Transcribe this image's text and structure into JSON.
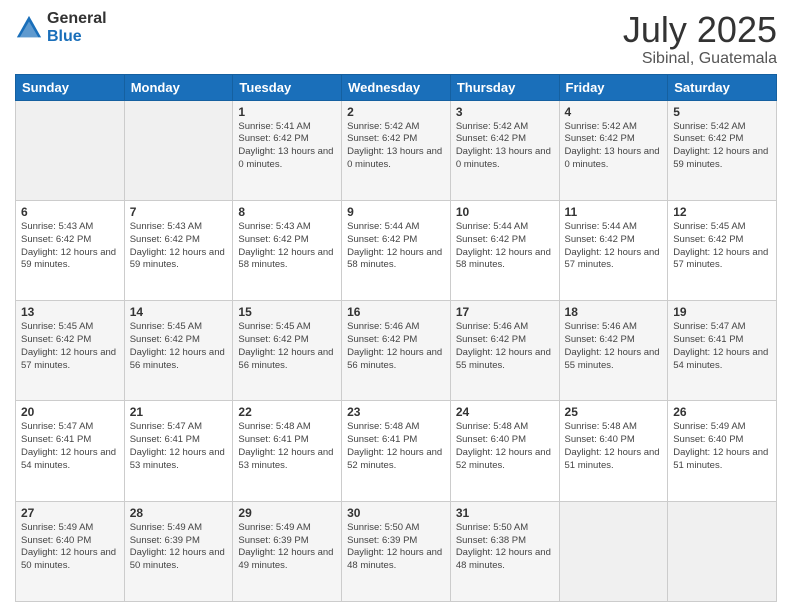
{
  "logo": {
    "general": "General",
    "blue": "Blue"
  },
  "header": {
    "title": "July 2025",
    "subtitle": "Sibinal, Guatemala"
  },
  "days_of_week": [
    "Sunday",
    "Monday",
    "Tuesday",
    "Wednesday",
    "Thursday",
    "Friday",
    "Saturday"
  ],
  "weeks": [
    [
      {
        "day": "",
        "info": ""
      },
      {
        "day": "",
        "info": ""
      },
      {
        "day": "1",
        "info": "Sunrise: 5:41 AM\nSunset: 6:42 PM\nDaylight: 13 hours and 0 minutes."
      },
      {
        "day": "2",
        "info": "Sunrise: 5:42 AM\nSunset: 6:42 PM\nDaylight: 13 hours and 0 minutes."
      },
      {
        "day": "3",
        "info": "Sunrise: 5:42 AM\nSunset: 6:42 PM\nDaylight: 13 hours and 0 minutes."
      },
      {
        "day": "4",
        "info": "Sunrise: 5:42 AM\nSunset: 6:42 PM\nDaylight: 13 hours and 0 minutes."
      },
      {
        "day": "5",
        "info": "Sunrise: 5:42 AM\nSunset: 6:42 PM\nDaylight: 12 hours and 59 minutes."
      }
    ],
    [
      {
        "day": "6",
        "info": "Sunrise: 5:43 AM\nSunset: 6:42 PM\nDaylight: 12 hours and 59 minutes."
      },
      {
        "day": "7",
        "info": "Sunrise: 5:43 AM\nSunset: 6:42 PM\nDaylight: 12 hours and 59 minutes."
      },
      {
        "day": "8",
        "info": "Sunrise: 5:43 AM\nSunset: 6:42 PM\nDaylight: 12 hours and 58 minutes."
      },
      {
        "day": "9",
        "info": "Sunrise: 5:44 AM\nSunset: 6:42 PM\nDaylight: 12 hours and 58 minutes."
      },
      {
        "day": "10",
        "info": "Sunrise: 5:44 AM\nSunset: 6:42 PM\nDaylight: 12 hours and 58 minutes."
      },
      {
        "day": "11",
        "info": "Sunrise: 5:44 AM\nSunset: 6:42 PM\nDaylight: 12 hours and 57 minutes."
      },
      {
        "day": "12",
        "info": "Sunrise: 5:45 AM\nSunset: 6:42 PM\nDaylight: 12 hours and 57 minutes."
      }
    ],
    [
      {
        "day": "13",
        "info": "Sunrise: 5:45 AM\nSunset: 6:42 PM\nDaylight: 12 hours and 57 minutes."
      },
      {
        "day": "14",
        "info": "Sunrise: 5:45 AM\nSunset: 6:42 PM\nDaylight: 12 hours and 56 minutes."
      },
      {
        "day": "15",
        "info": "Sunrise: 5:45 AM\nSunset: 6:42 PM\nDaylight: 12 hours and 56 minutes."
      },
      {
        "day": "16",
        "info": "Sunrise: 5:46 AM\nSunset: 6:42 PM\nDaylight: 12 hours and 56 minutes."
      },
      {
        "day": "17",
        "info": "Sunrise: 5:46 AM\nSunset: 6:42 PM\nDaylight: 12 hours and 55 minutes."
      },
      {
        "day": "18",
        "info": "Sunrise: 5:46 AM\nSunset: 6:42 PM\nDaylight: 12 hours and 55 minutes."
      },
      {
        "day": "19",
        "info": "Sunrise: 5:47 AM\nSunset: 6:41 PM\nDaylight: 12 hours and 54 minutes."
      }
    ],
    [
      {
        "day": "20",
        "info": "Sunrise: 5:47 AM\nSunset: 6:41 PM\nDaylight: 12 hours and 54 minutes."
      },
      {
        "day": "21",
        "info": "Sunrise: 5:47 AM\nSunset: 6:41 PM\nDaylight: 12 hours and 53 minutes."
      },
      {
        "day": "22",
        "info": "Sunrise: 5:48 AM\nSunset: 6:41 PM\nDaylight: 12 hours and 53 minutes."
      },
      {
        "day": "23",
        "info": "Sunrise: 5:48 AM\nSunset: 6:41 PM\nDaylight: 12 hours and 52 minutes."
      },
      {
        "day": "24",
        "info": "Sunrise: 5:48 AM\nSunset: 6:40 PM\nDaylight: 12 hours and 52 minutes."
      },
      {
        "day": "25",
        "info": "Sunrise: 5:48 AM\nSunset: 6:40 PM\nDaylight: 12 hours and 51 minutes."
      },
      {
        "day": "26",
        "info": "Sunrise: 5:49 AM\nSunset: 6:40 PM\nDaylight: 12 hours and 51 minutes."
      }
    ],
    [
      {
        "day": "27",
        "info": "Sunrise: 5:49 AM\nSunset: 6:40 PM\nDaylight: 12 hours and 50 minutes."
      },
      {
        "day": "28",
        "info": "Sunrise: 5:49 AM\nSunset: 6:39 PM\nDaylight: 12 hours and 50 minutes."
      },
      {
        "day": "29",
        "info": "Sunrise: 5:49 AM\nSunset: 6:39 PM\nDaylight: 12 hours and 49 minutes."
      },
      {
        "day": "30",
        "info": "Sunrise: 5:50 AM\nSunset: 6:39 PM\nDaylight: 12 hours and 48 minutes."
      },
      {
        "day": "31",
        "info": "Sunrise: 5:50 AM\nSunset: 6:38 PM\nDaylight: 12 hours and 48 minutes."
      },
      {
        "day": "",
        "info": ""
      },
      {
        "day": "",
        "info": ""
      }
    ]
  ]
}
